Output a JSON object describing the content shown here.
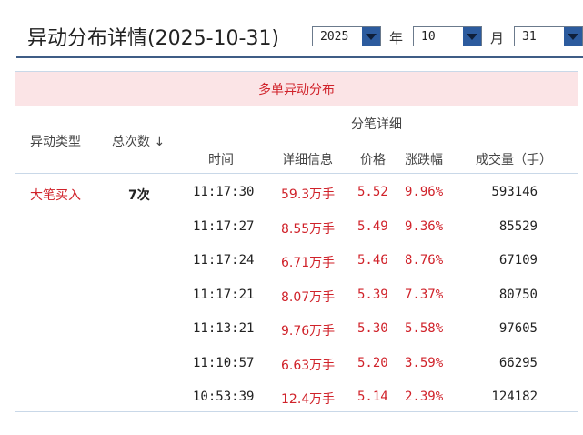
{
  "page": {
    "title": "异动分布详情(2025-10-31)"
  },
  "date_picker": {
    "year": "2025",
    "year_unit": "年",
    "month": "10",
    "month_unit": "月",
    "day": "31"
  },
  "section": {
    "banner": "多单异动分布"
  },
  "table": {
    "col_type": "异动类型",
    "col_count": "总次数",
    "sort_arrow": "↓",
    "group_header": "分笔详细",
    "col_time": "时间",
    "col_detail": "详细信息",
    "col_price": "价格",
    "col_change": "涨跌幅",
    "col_volume": "成交量（手）",
    "group": {
      "type": "大笔买入",
      "count": "7次"
    },
    "rows": [
      {
        "time": "11:17:30",
        "detail": "59.3万手",
        "price": "5.52",
        "change": "9.96%",
        "volume": "593146"
      },
      {
        "time": "11:17:27",
        "detail": "8.55万手",
        "price": "5.49",
        "change": "9.36%",
        "volume": "85529"
      },
      {
        "time": "11:17:24",
        "detail": "6.71万手",
        "price": "5.46",
        "change": "8.76%",
        "volume": "67109"
      },
      {
        "time": "11:17:21",
        "detail": "8.07万手",
        "price": "5.39",
        "change": "7.37%",
        "volume": "80750"
      },
      {
        "time": "11:13:21",
        "detail": "9.76万手",
        "price": "5.30",
        "change": "5.58%",
        "volume": "97605"
      },
      {
        "time": "11:10:57",
        "detail": "6.63万手",
        "price": "5.20",
        "change": "3.59%",
        "volume": "66295"
      },
      {
        "time": "10:53:39",
        "detail": "12.4万手",
        "price": "5.14",
        "change": "2.39%",
        "volume": "124182"
      }
    ]
  },
  "colors": {
    "accent_red": "#d0222a",
    "banner_bg": "#fbe4e6",
    "select_arrow": "#2c5b9e",
    "rule": "#3f5d86"
  }
}
